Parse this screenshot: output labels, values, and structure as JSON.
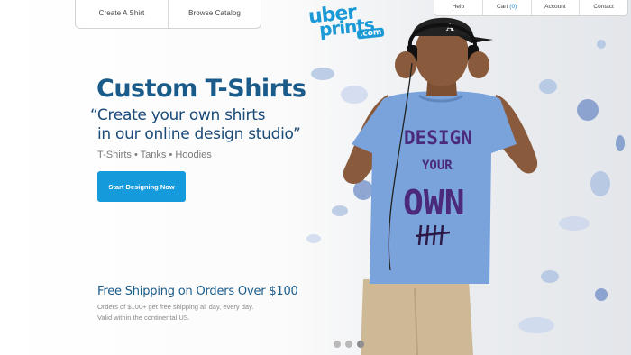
{
  "left_nav": {
    "items": [
      {
        "label": "Create A Shirt"
      },
      {
        "label": "Browse Catalog"
      }
    ]
  },
  "right_nav": {
    "help": "Help",
    "cart": "Cart",
    "cart_count": "(0)",
    "account": "Account",
    "contact": "Contact"
  },
  "logo": {
    "line1": "uber",
    "line2": "prints",
    "line3": ".com"
  },
  "hero": {
    "title": "Custom T-Shirts",
    "quote_line1": "“Create your own shirts",
    "quote_line2": "in our online design studio”",
    "subtitle": "T-Shirts • Tanks • Hoodies",
    "cta_label": "Start Designing Now"
  },
  "promo": {
    "title": "Free Shipping on Orders Over $100",
    "desc_line1": "Orders of $100+ get free shipping all day, every day.",
    "desc_line2": "Valid within the continental US."
  },
  "shirt": {
    "line1": "DESIGN",
    "line2": "YOUR",
    "line3": "OWN"
  },
  "carousel": {
    "slide_count": 3,
    "active_index": 2
  },
  "colors": {
    "brand_blue": "#159bdb",
    "heading_blue": "#1a5b8a",
    "shirt_blue": "#7aa3dc",
    "print_purple": "#4b2a7a"
  }
}
